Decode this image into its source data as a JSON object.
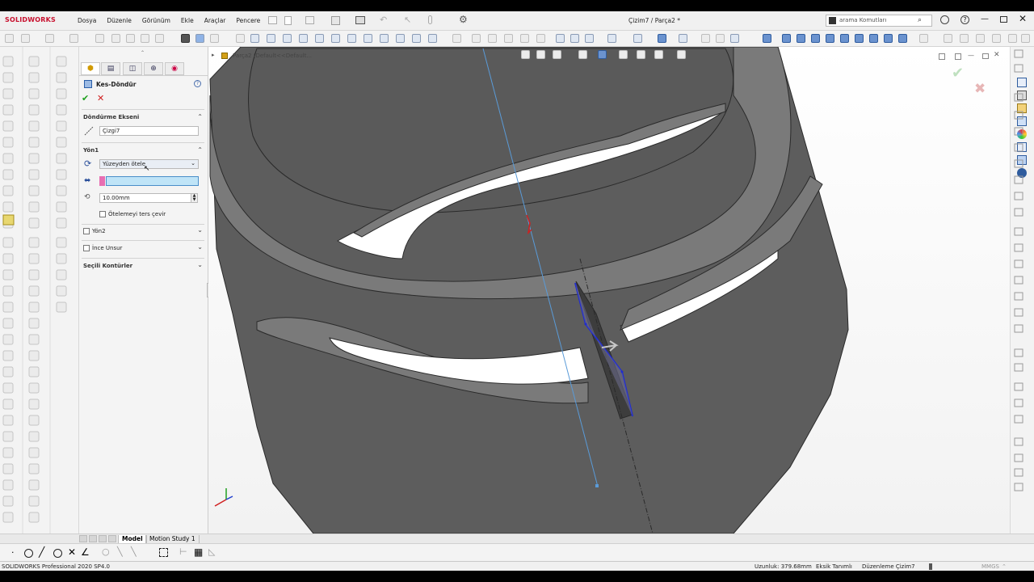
{
  "app": {
    "logo_text": "SOLIDWORKS",
    "window_title": "Çizim7 / Parça2 *",
    "menu": [
      "Dosya",
      "Düzenle",
      "Görünüm",
      "Ekle",
      "Araçlar",
      "Pencere"
    ],
    "search_placeholder": "arama Komutları"
  },
  "feature_manager": {
    "feature_title": "Kes-Döndür",
    "ok_icon": "check-icon",
    "cancel_icon": "close-icon",
    "axis_section": {
      "label": "Döndürme Ekseni",
      "value": "Çizgi7"
    },
    "direction1": {
      "label": "Yön1",
      "end_condition": "Yüzeyden ötele",
      "offset": "10.00mm",
      "reverse_offset_label": "Ötelemeyi ters çevir"
    },
    "direction2_label": "Yön2",
    "thin_feature_label": "İnce Unsur",
    "selected_contours_label": "Seçili Kontürler"
  },
  "viewport": {
    "breadcrumb": "Parça2 (Default<<Default..."
  },
  "bottom_tabs": [
    "Model",
    "Motion Study 1"
  ],
  "status": {
    "version": "SOLIDWORKS Professional 2020 SP4.0",
    "length": "Uzunluk: 379.68mm",
    "definition": "Eksik Tanımlı",
    "editing": "Düzenleme Çizim7",
    "units": "MMGS"
  },
  "colors": {
    "body": "#5a5a5a",
    "body_top": "#777777",
    "edge": "#2a2a2a",
    "axis_line": "#5a9bd8",
    "sketch_line": "#1f2bd0",
    "accept": "#20a020",
    "reject": "#d02020",
    "highlight_field": "#bfe4f7"
  }
}
